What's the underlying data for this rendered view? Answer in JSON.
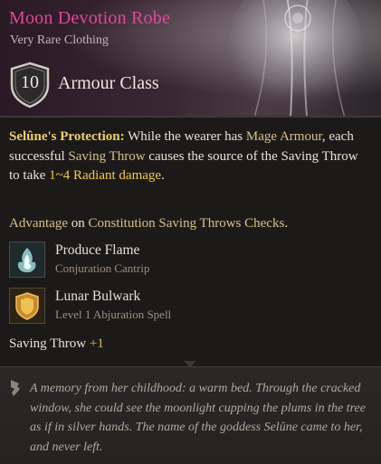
{
  "item": {
    "name": "Moon Devotion Robe",
    "rarity_type": "Very Rare Clothing",
    "armour_class_value": "10",
    "armour_class_label": "Armour Class"
  },
  "description": {
    "ability_name": "Selûne's Protection:",
    "part1": " While the wearer has ",
    "kw_mage_armour": "Mage Armour",
    "part2": ", each successful ",
    "kw_saving_throw": "Saving Throw",
    "part3": " causes the source of the Saving Throw to take ",
    "kw_damage": "1~4 Radiant damage",
    "part4": "."
  },
  "advantage": {
    "kw_advantage": "Advantage",
    "on": " on ",
    "kw_constitution": "Constitution Saving Throws",
    "space": " ",
    "kw_checks": "Checks",
    "period": "."
  },
  "spells": [
    {
      "name": "Produce Flame",
      "type": "Conjuration Cantrip",
      "icon": "produce-flame-icon"
    },
    {
      "name": "Lunar Bulwark",
      "type": "Level 1 Abjuration Spell",
      "icon": "lunar-bulwark-icon"
    }
  ],
  "saving_throw": {
    "label": "Saving Throw",
    "bonus": "+1"
  },
  "lore": "A memory from her childhood: a warm bed. Through the cracked window, she could see the moonlight cupping the plums in the tree as if in silver hands. The name of the goddess Selûne came to her, and never left.",
  "colors": {
    "title": "#e0479a",
    "keyword": "#d6c08a",
    "highlight": "#f3c94c",
    "background": "#1c1a19"
  }
}
